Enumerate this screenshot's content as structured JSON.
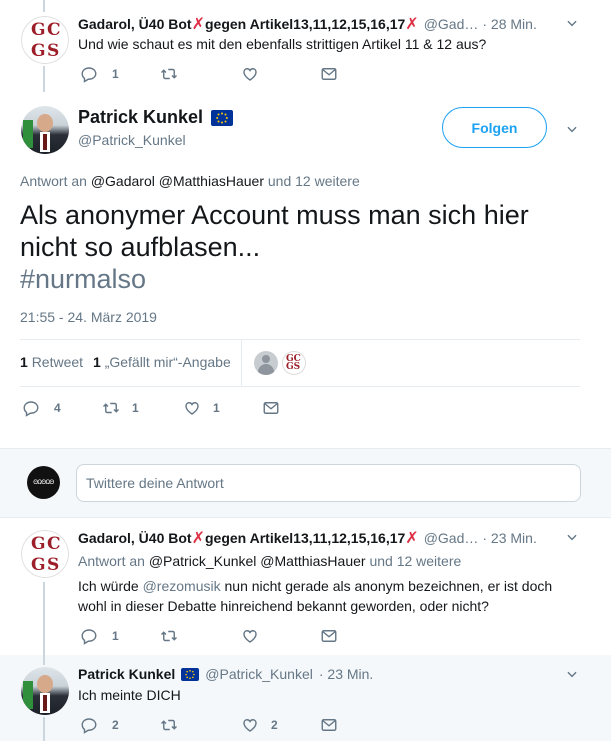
{
  "tweet1": {
    "author_name": "Gadarol, Ü40 Bot",
    "name_mid": "gegen Artikel13,11,12,15,16,17",
    "handle": "@Gad…",
    "time": "· 28 Min.",
    "text": "Und wie schaut es mit den ebenfalls strittigen Artikel 11 & 12 aus?",
    "reply_count": "1",
    "retweet_count": "",
    "like_count": ""
  },
  "main": {
    "author_name": "Patrick Kunkel",
    "handle": "@Patrick_Kunkel",
    "follow_label": "Folgen",
    "reply_to_prefix": "Antwort an",
    "reply_to_users": "@Gadarol @MatthiasHauer",
    "reply_to_more": "und 12 weitere",
    "text_line1": "Als anonymer Account muss man sich hier",
    "text_line2": "nicht so aufblasen...",
    "hashtag": "#nurmalso",
    "timestamp": "21:55 - 24. März 2019",
    "retweets_num": "1",
    "retweets_label": "Retweet",
    "likes_num": "1",
    "likes_label": "„Gefällt mir“-Angabe",
    "reply_count": "4",
    "retweet_count": "1",
    "like_count": "1"
  },
  "compose": {
    "placeholder": "Twittere deine Antwort",
    "avatar_text": "ΘΩΘΩΘ"
  },
  "tweet2": {
    "author_name": "Gadarol, Ü40 Bot",
    "name_mid": "gegen Artikel13,11,12,15,16,17",
    "handle": "@Gad…",
    "time": "· 23 Min.",
    "reply_to_prefix": "Antwort an",
    "reply_to_users": "@Patrick_Kunkel @MatthiasHauer",
    "reply_to_more": "und 12 weitere",
    "text_prefix": "Ich würde ",
    "mention": "@rezomusik",
    "text_rest": " nun nicht gerade als anonym bezeichnen, er ist doch",
    "text_line2": "wohl in dieser Debatte hinreichend bekannt geworden, oder nicht?",
    "reply_count": "1",
    "retweet_count": "",
    "like_count": ""
  },
  "tweet3": {
    "author_name": "Patrick Kunkel",
    "handle": "@Patrick_Kunkel",
    "time": "· 23 Min.",
    "text": "Ich meinte DICH",
    "reply_count": "2",
    "retweet_count": "",
    "like_count": "2"
  },
  "colors": {
    "accent": "#1da1f2",
    "muted": "#657786",
    "highlight_bg": "#f5f8fa",
    "x_mark": "#dd2e44"
  },
  "icons": [
    "reply-icon",
    "retweet-icon",
    "like-icon",
    "dm-icon",
    "chevron-down-icon",
    "eu-flag-icon",
    "x-mark-icon"
  ]
}
